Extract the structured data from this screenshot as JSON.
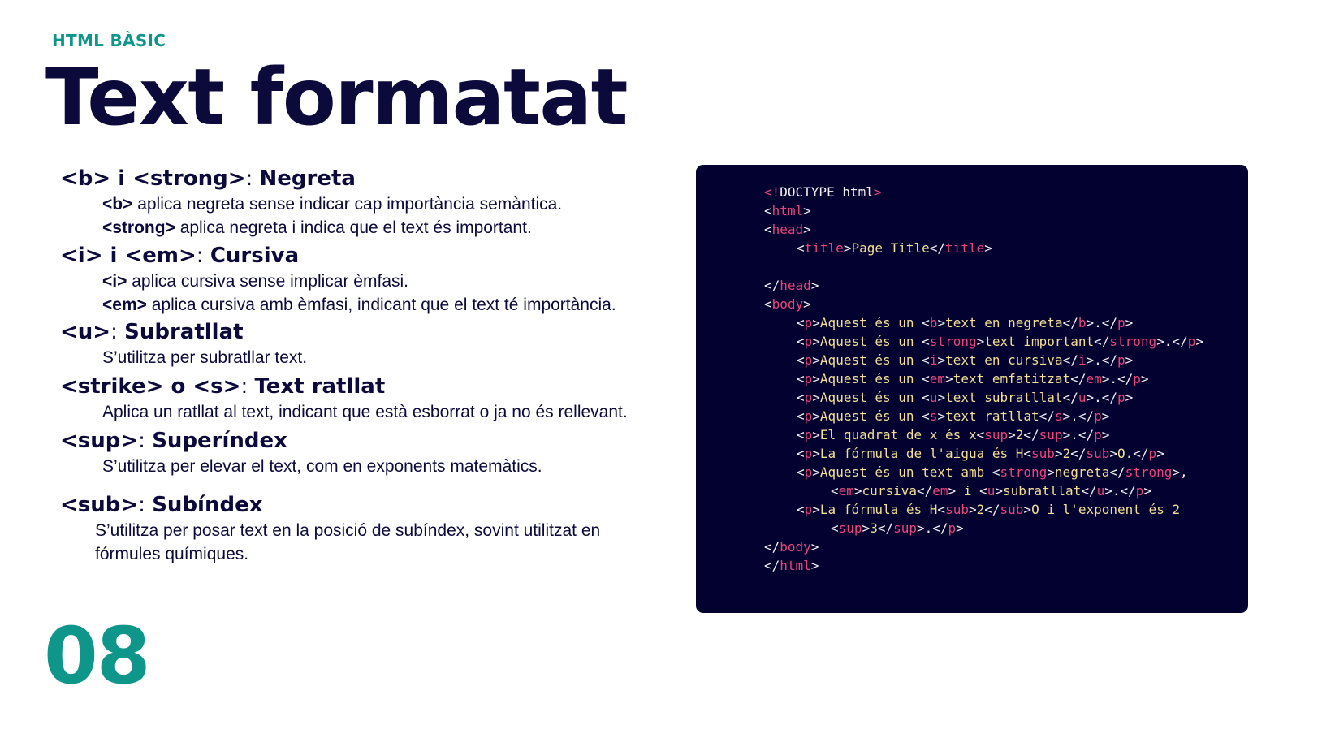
{
  "slide": {
    "kicker": "HTML BÀSIC",
    "title": "Text formatat",
    "page_number": "08"
  },
  "sections": {
    "bold": {
      "heading": "<b> i <strong>",
      "heading_value": "Negreta",
      "lines": [
        {
          "tag": "<b>",
          "text": " aplica negreta sense indicar cap importància semàntica."
        },
        {
          "tag": "<strong>",
          "text": " aplica negreta i indica que el text és important."
        }
      ]
    },
    "italic": {
      "heading": "<i> i <em>",
      "heading_value": "Cursiva",
      "lines": [
        {
          "tag": "<i>",
          "text": " aplica cursiva sense implicar èmfasi."
        },
        {
          "tag": "<em>",
          "text": " aplica cursiva amb èmfasi, indicant que el text té importància."
        }
      ]
    },
    "underline": {
      "heading": "<u>",
      "heading_value": "Subratllat",
      "text": "S’utilitza per subratllar text."
    },
    "strike": {
      "heading": "<strike> o <s>",
      "heading_value": "Text ratllat",
      "text": "Aplica un ratllat al text, indicant que està esborrat o ja no és rellevant."
    },
    "sup": {
      "heading": "<sup>",
      "heading_value": "Superíndex",
      "text": "S’utilitza per elevar el text, com en exponents matemàtics."
    },
    "sub": {
      "heading": "<sub>",
      "heading_value": "Subíndex",
      "text_line1": "S’utilitza per posar text en la posició de subíndex, sovint utilitzat en",
      "text_line2": "fórmules químiques."
    }
  },
  "code": {
    "doctype": "DOCTYPE html",
    "page_title": "Page Title",
    "t_aquest": "Aquest és un ",
    "t_negreta": "text en negreta",
    "t_important": "text important",
    "t_cursiva": "text en cursiva",
    "t_emfatitzat": "text emfatitzat",
    "t_subratllat": "text subratllat",
    "t_ratllat": "text ratllat",
    "t_quadrat": "El quadrat de x és x",
    "t_aigua": "La fórmula de l'aigua és H",
    "t_o": "O.",
    "t_mix": "Aquest és un text amb ",
    "t_w_negreta": "negreta",
    "t_w_cursiva": "cursiva",
    "t_w_subratllat": "subratllat",
    "t_i": " i ",
    "t_formula": "La fórmula és H",
    "t_exponent": "O i l'exponent és 2",
    "n2": "2",
    "n3": "3"
  },
  "colors": {
    "accent_teal": "#0f968a",
    "navy": "#0b0a3a",
    "code_bg": "#03012f",
    "code_tag": "#e9457c",
    "code_text": "#f4dd96"
  }
}
